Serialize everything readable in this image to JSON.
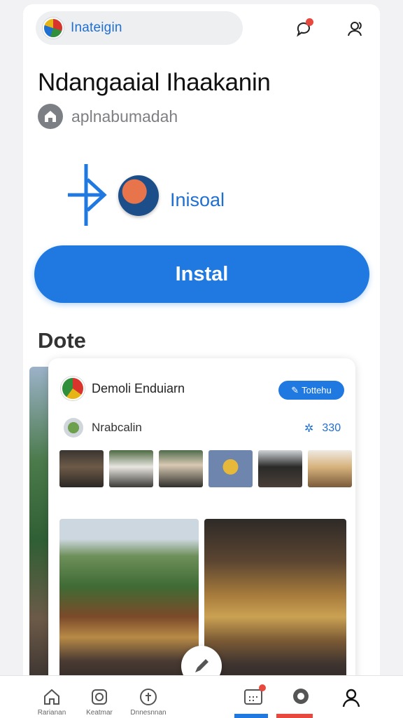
{
  "header": {
    "app_name": "Inateigin",
    "chat_icon": "chat-bubble-icon",
    "profile_icon": "people-icon"
  },
  "app": {
    "title": "Ndangaaial Ihaakanin",
    "developer": "aplnabumadah"
  },
  "install_promo": {
    "label": "Inisoal"
  },
  "install_button": {
    "label": "Instal"
  },
  "section": {
    "title": "Dote"
  },
  "card": {
    "title": "Demoli Enduiarn",
    "badge": "Tottehu",
    "sub_name": "Nrabcalin",
    "rating": "330"
  },
  "bottom_nav": {
    "items": [
      {
        "label": "Rarianan",
        "icon": "home-icon"
      },
      {
        "label": "Keatmar",
        "icon": "camera-icon"
      },
      {
        "label": "Dnnesnnan",
        "icon": "info-icon"
      },
      {
        "label": "",
        "icon": "calendar-icon"
      },
      {
        "label": "",
        "icon": "location-icon"
      },
      {
        "label": "",
        "icon": "person-icon"
      }
    ]
  },
  "colors": {
    "accent": "#1f79e0",
    "notification": "#e8493f"
  }
}
